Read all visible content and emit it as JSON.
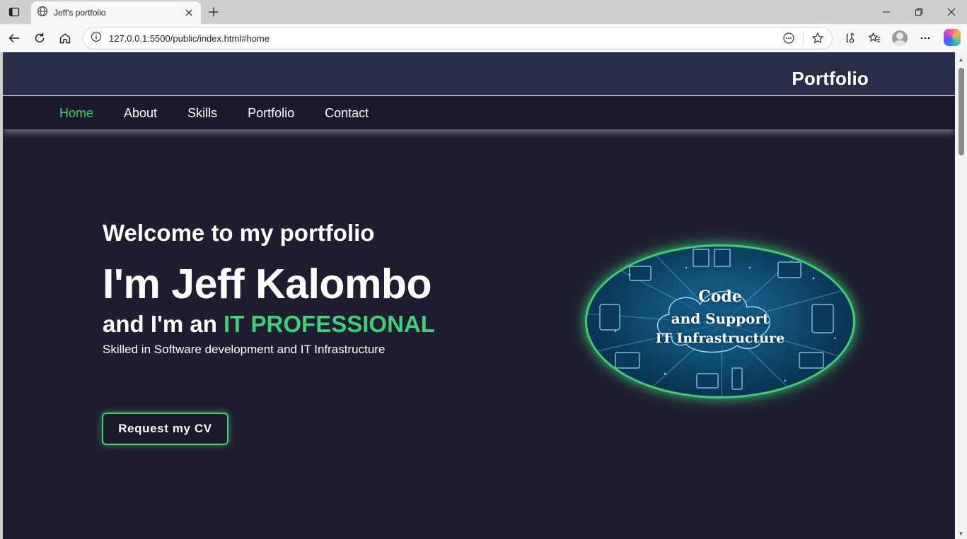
{
  "browser": {
    "tab_title": "Jeff's portfolio",
    "url": "127.0.0.1:5500/public/index.html#home"
  },
  "site": {
    "brand": "Portfolio",
    "nav": [
      {
        "label": "Home",
        "active": true
      },
      {
        "label": "About",
        "active": false
      },
      {
        "label": "Skills",
        "active": false
      },
      {
        "label": "Portfolio",
        "active": false
      },
      {
        "label": "Contact",
        "active": false
      }
    ],
    "hero": {
      "welcome": "Welcome to my portfolio",
      "name": "I'm Jeff Kalombo",
      "role_prefix": "and I'm an ",
      "role_accent": "IT PROFESSIONAL",
      "skills": "Skilled in Software development and IT Infrastructure",
      "cta": "Request my CV",
      "image_caption": [
        "Code",
        "and Support",
        "IT Infrastructure"
      ]
    }
  },
  "colors": {
    "page_bg": "#1e1d31",
    "header_bg": "#2a2d47",
    "nav_bg": "#1b1a2c",
    "accent": "#3fcf74"
  }
}
